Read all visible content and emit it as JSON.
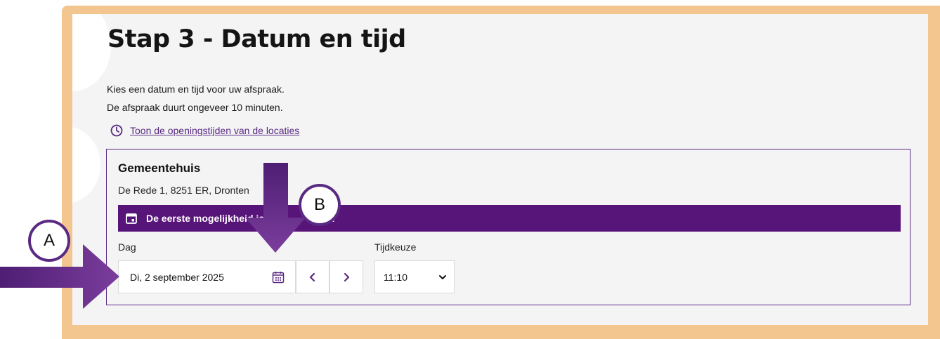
{
  "header": {
    "title": "Stap 3 - Datum en tijd"
  },
  "intro": {
    "line1": "Kies een datum en tijd voor uw afspraak.",
    "line2": "De afspraak duurt ongeveer 10 minuten."
  },
  "hours_link": {
    "label": "Toon de openingstijden van de locaties",
    "icon": "clock-icon"
  },
  "location": {
    "name": "Gemeentehuis",
    "address": "De Rede 1, 8251 ER, Dronten",
    "banner_text": "De eerste mogelijkheid is a",
    "banner_text_tail": "d",
    "banner_icon": "calendar-icon"
  },
  "day_field": {
    "label": "Dag",
    "value": "Di, 2 september 2025",
    "icon": "calendar-icon"
  },
  "nav": {
    "prev_icon": "chevron-left-icon",
    "next_icon": "chevron-right-icon"
  },
  "time_field": {
    "label": "Tijdkeuze",
    "value": "11:10",
    "icon": "chevron-down-icon"
  },
  "annotations": {
    "a_label": "A",
    "b_label": "B"
  },
  "colors": {
    "accent": "#5a2a82",
    "banner": "#571479",
    "frame": "#f3c690",
    "panel": "#f4f4f5"
  }
}
